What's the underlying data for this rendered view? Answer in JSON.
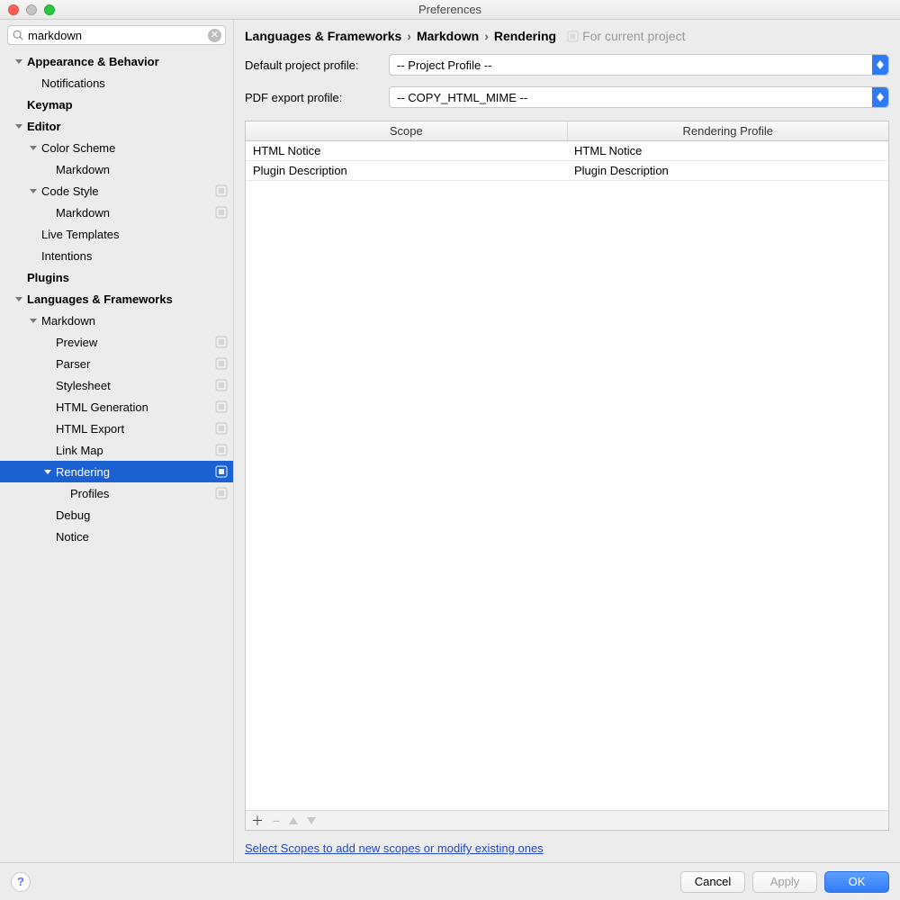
{
  "window": {
    "title": "Preferences"
  },
  "search": {
    "value": "markdown"
  },
  "tree": [
    {
      "indent": 0,
      "label": "Appearance & Behavior",
      "bold": true,
      "expanded": true,
      "children": true,
      "name": "tree-appearance-behavior"
    },
    {
      "indent": 1,
      "label": "Notifications",
      "name": "tree-notifications"
    },
    {
      "indent": 0,
      "label": "Keymap",
      "bold": true,
      "name": "tree-keymap"
    },
    {
      "indent": 0,
      "label": "Editor",
      "bold": true,
      "expanded": true,
      "children": true,
      "name": "tree-editor"
    },
    {
      "indent": 1,
      "label": "Color Scheme",
      "expanded": true,
      "children": true,
      "name": "tree-color-scheme"
    },
    {
      "indent": 2,
      "label": "Markdown",
      "name": "tree-color-scheme-markdown"
    },
    {
      "indent": 1,
      "label": "Code Style",
      "expanded": true,
      "children": true,
      "badge": true,
      "name": "tree-code-style"
    },
    {
      "indent": 2,
      "label": "Markdown",
      "badge": true,
      "name": "tree-code-style-markdown"
    },
    {
      "indent": 1,
      "label": "Live Templates",
      "name": "tree-live-templates"
    },
    {
      "indent": 1,
      "label": "Intentions",
      "name": "tree-intentions"
    },
    {
      "indent": 0,
      "label": "Plugins",
      "bold": true,
      "name": "tree-plugins"
    },
    {
      "indent": 0,
      "label": "Languages & Frameworks",
      "bold": true,
      "expanded": true,
      "children": true,
      "name": "tree-languages-frameworks"
    },
    {
      "indent": 1,
      "label": "Markdown",
      "expanded": true,
      "children": true,
      "name": "tree-markdown"
    },
    {
      "indent": 2,
      "label": "Preview",
      "badge": true,
      "name": "tree-preview"
    },
    {
      "indent": 2,
      "label": "Parser",
      "badge": true,
      "name": "tree-parser"
    },
    {
      "indent": 2,
      "label": "Stylesheet",
      "badge": true,
      "name": "tree-stylesheet"
    },
    {
      "indent": 2,
      "label": "HTML Generation",
      "badge": true,
      "name": "tree-html-generation"
    },
    {
      "indent": 2,
      "label": "HTML Export",
      "badge": true,
      "name": "tree-html-export"
    },
    {
      "indent": 2,
      "label": "Link Map",
      "badge": true,
      "name": "tree-link-map"
    },
    {
      "indent": 2,
      "label": "Rendering",
      "expanded": true,
      "children": true,
      "badge": true,
      "selected": true,
      "name": "tree-rendering"
    },
    {
      "indent": 3,
      "label": "Profiles",
      "badge": true,
      "name": "tree-profiles"
    },
    {
      "indent": 2,
      "label": "Debug",
      "name": "tree-debug"
    },
    {
      "indent": 2,
      "label": "Notice",
      "name": "tree-notice"
    }
  ],
  "breadcrumb": {
    "parts": [
      "Languages & Frameworks",
      "Markdown",
      "Rendering"
    ],
    "hint": "For current project"
  },
  "form": {
    "default_profile_label": "Default project profile:",
    "default_profile_value": "-- Project Profile --",
    "pdf_profile_label": "PDF export profile:",
    "pdf_profile_value": "-- COPY_HTML_MIME --"
  },
  "table": {
    "headers": [
      "Scope",
      "Rendering Profile"
    ],
    "rows": [
      {
        "scope": "HTML Notice",
        "profile": "HTML Notice"
      },
      {
        "scope": "Plugin Description",
        "profile": "Plugin Description"
      }
    ]
  },
  "link": {
    "text": "Select Scopes to add new scopes or modify existing ones"
  },
  "footer": {
    "help": "?",
    "cancel": "Cancel",
    "apply": "Apply",
    "ok": "OK"
  }
}
